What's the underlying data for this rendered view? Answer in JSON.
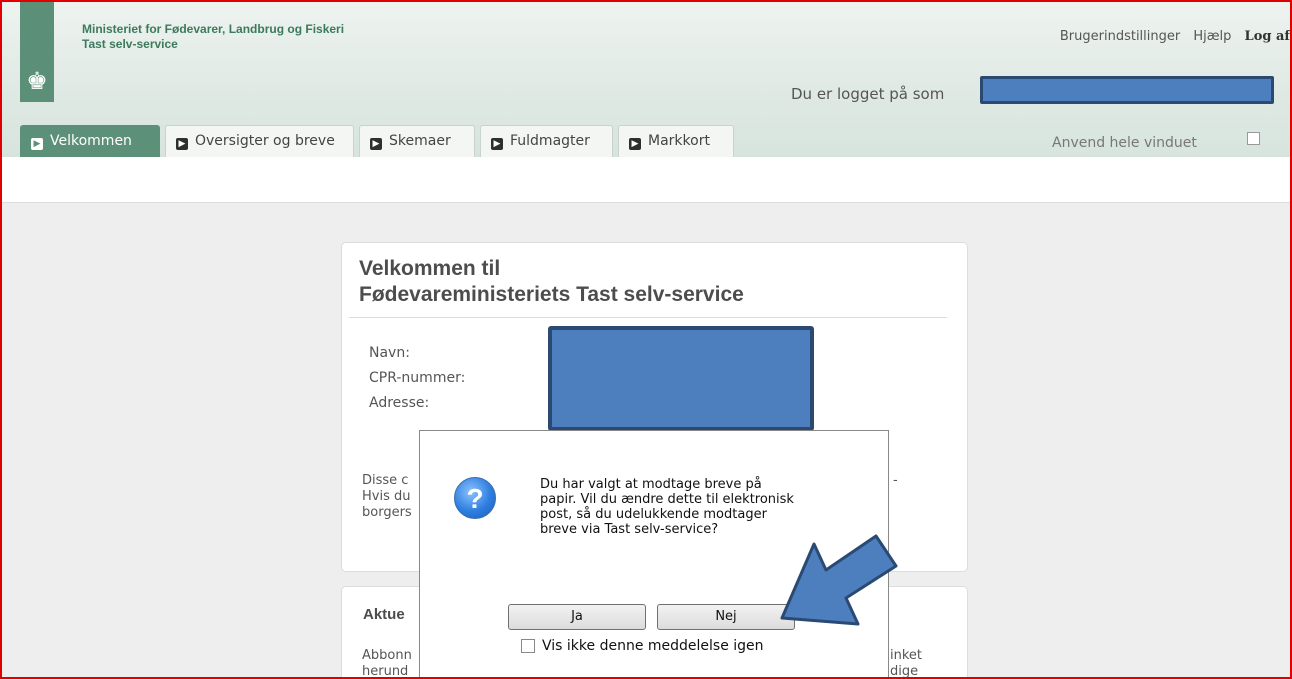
{
  "header": {
    "ministry": "Ministeriet for Fødevarer, Landbrug og Fiskeri",
    "service": "Tast selv-service",
    "links": [
      "Brugerindstillinger",
      "Hjælp",
      "Log af"
    ],
    "logged_in_label": "Du er logget på som"
  },
  "tabs": [
    "Velkommen",
    "Oversigter og breve",
    "Skemaer",
    "Fuldmagter",
    "Markkort"
  ],
  "full_window_label": "Anvend hele vinduet",
  "welcome": {
    "title_line1": "Velkommen til",
    "title_line2": "Fødevareministeriets Tast selv-service",
    "labels": [
      "Navn:",
      "CPR-nummer:",
      "Adresse:"
    ],
    "para_lines": [
      "Disse c",
      "Hvis du",
      "borgers"
    ],
    "right_fragment": "-"
  },
  "aktuel": {
    "title": "Aktue",
    "lines": [
      "Abbonn",
      "herund"
    ],
    "right_lines": [
      "inket",
      "dige"
    ]
  },
  "dialog": {
    "message_lines": [
      "Du har valgt at modtage breve på",
      "papir. Vil du ændre dette til elektronisk",
      "post, så du udelukkende modtager",
      "breve via Tast selv-service?"
    ],
    "yes_label": "Ja",
    "no_label": "Nej",
    "checkbox_label": "Vis ikke denne meddelelse igen"
  },
  "colors": {
    "accent_green": "#5d9078",
    "redaction_blue": "#4d7fbe",
    "annotation_border": "#e00000"
  }
}
